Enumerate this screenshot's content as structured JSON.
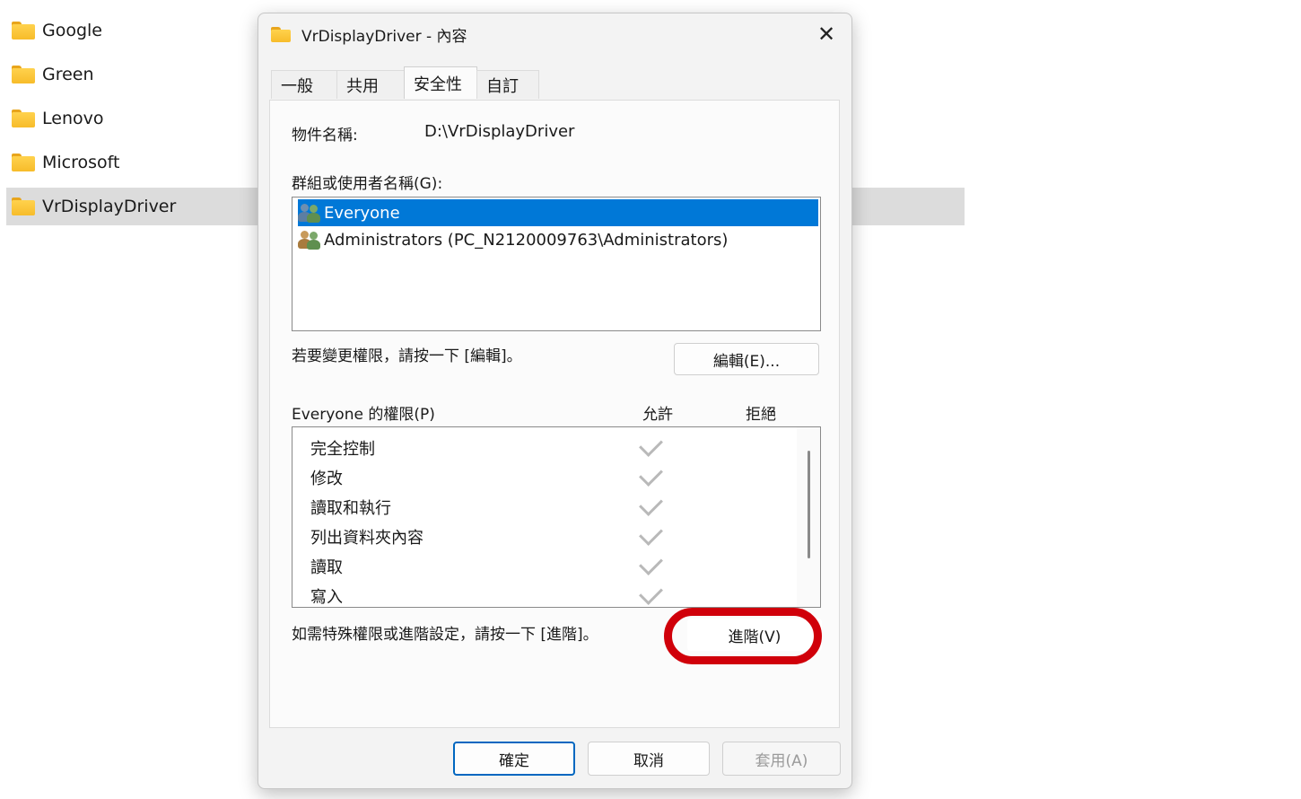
{
  "explorer": {
    "folders": [
      {
        "label": "Google"
      },
      {
        "label": "Green"
      },
      {
        "label": "Lenovo"
      },
      {
        "label": "Microsoft"
      },
      {
        "label": "VrDisplayDriver",
        "selected": true
      }
    ]
  },
  "dialog": {
    "title": "VrDisplayDriver - 內容",
    "close_glyph": "✕",
    "tabs": [
      {
        "label": "一般"
      },
      {
        "label": "共用"
      },
      {
        "label": "安全性",
        "active": true
      },
      {
        "label": "自訂"
      }
    ],
    "object_name_label": "物件名稱:",
    "object_name_value": "D:\\VrDisplayDriver",
    "groups_label": "群組或使用者名稱(G):",
    "users": [
      {
        "label": "Everyone",
        "selected": true
      },
      {
        "label": "Administrators (PC_N2120009763\\Administrators)"
      }
    ],
    "change_hint": "若要變更權限，請按一下 [編輯]。",
    "edit_button": "編輯(E)...",
    "permissions_label": "Everyone 的權限(P)",
    "allow_header": "允許",
    "deny_header": "拒絕",
    "permissions": [
      {
        "label": "完全控制",
        "allow": true
      },
      {
        "label": "修改",
        "allow": true
      },
      {
        "label": "讀取和執行",
        "allow": true
      },
      {
        "label": "列出資料夾內容",
        "allow": true
      },
      {
        "label": "讀取",
        "allow": true
      },
      {
        "label": "寫入",
        "allow": true
      }
    ],
    "advanced_hint": "如需特殊權限或進階設定，請按一下 [進階]。",
    "advanced_button": "進階(V)",
    "ok_button": "確定",
    "cancel_button": "取消",
    "apply_button": "套用(A)"
  },
  "colors": {
    "selection": "#0078d7",
    "highlight_ring": "#d0000a",
    "primary_border": "#0067c0",
    "folder": "#f7bc2a"
  }
}
